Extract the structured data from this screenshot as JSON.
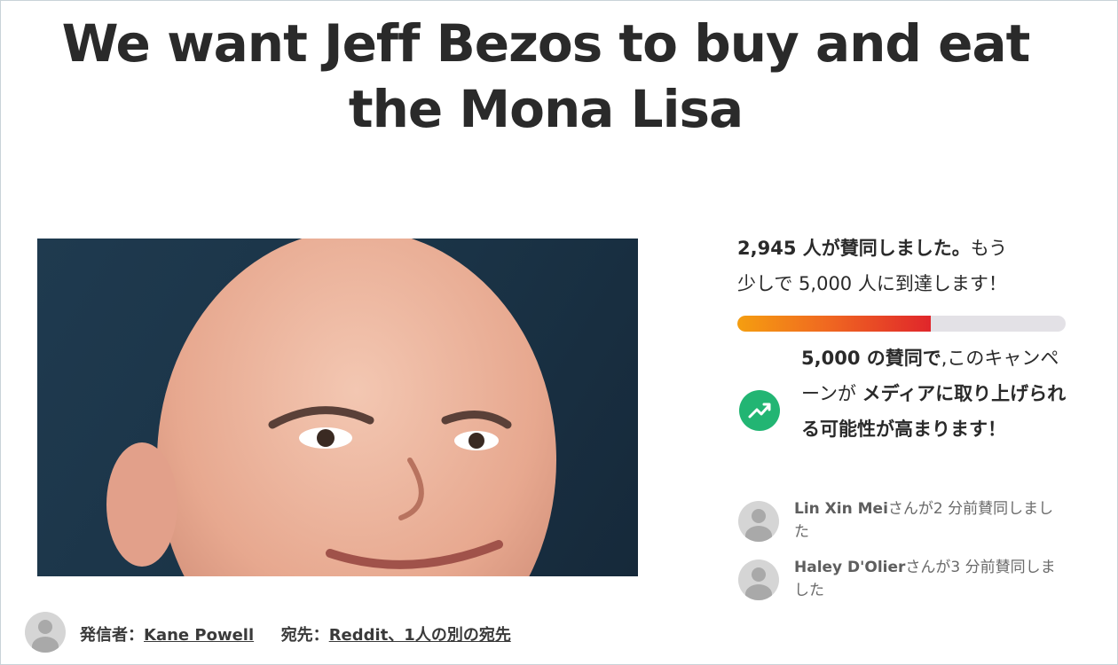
{
  "title": "We want Jeff Bezos to buy and eat the Mona Lisa",
  "photo": {
    "subject": "bald man smiling portrait"
  },
  "starter": {
    "label": "発信者：",
    "name": "Kane Powell",
    "recipient_label": "宛先：",
    "recipients": "Reddit、1人の別の宛先"
  },
  "progress": {
    "count": "2,945 人が賛同しました。",
    "rest_line1": "もう",
    "rest_line2": "少しで 5,000 人に到達します！",
    "signed": 2945,
    "goal": 5000,
    "fill_color": "#e0262b"
  },
  "media": {
    "part1": "5,000 の賛同で",
    "part2": ",このキャンペーンが ",
    "part3": "メディアに取り上げられる可能性が高まります！",
    "icon": "trending-up-icon",
    "icon_color": "#22b573"
  },
  "signers": [
    {
      "name": "Lin Xin Mei",
      "suffix": "さんが2 分前賛同しました"
    },
    {
      "name": "Haley D'Olier",
      "suffix": "さんが3 分前賛同しました"
    }
  ]
}
